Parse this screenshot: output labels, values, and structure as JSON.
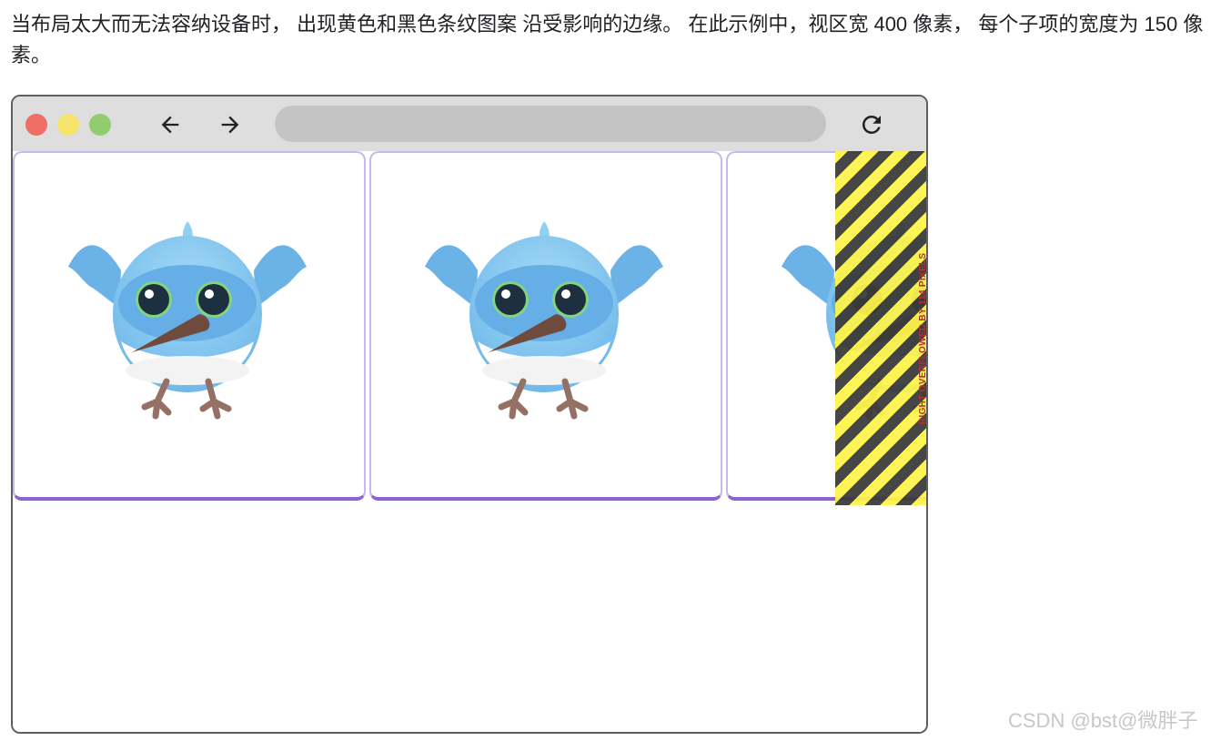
{
  "intro": {
    "text": "当布局太大而无法容纳设备时， 出现黄色和黑色条纹图案 沿受影响的边缘。 在此示例中，视区宽 400 像素， 每个子项的宽度为 150 像素。"
  },
  "browser": {
    "toolbar": {
      "window_controls": [
        "close",
        "minimize",
        "maximize"
      ],
      "back_icon": "arrow-left-icon",
      "forward_icon": "arrow-right-icon",
      "reload_icon": "reload-icon",
      "address_value": ""
    },
    "cards": [
      {
        "image": "bird-illustration"
      },
      {
        "image": "bird-illustration"
      },
      {
        "image": "bird-illustration"
      }
    ],
    "overflow": {
      "label": "RIGHT OVERFLOWED BY 114 PIXELS"
    }
  },
  "colors": {
    "close": "#ee6d65",
    "minimize": "#f6e36b",
    "maximize": "#92cc6f",
    "card_border": "#c9b8ec",
    "card_accent": "#8c63d2",
    "stripe_yellow": "#fdf34a",
    "stripe_black": "#3a3a3a"
  },
  "watermark": {
    "text": "CSDN @bst@微胖子"
  }
}
